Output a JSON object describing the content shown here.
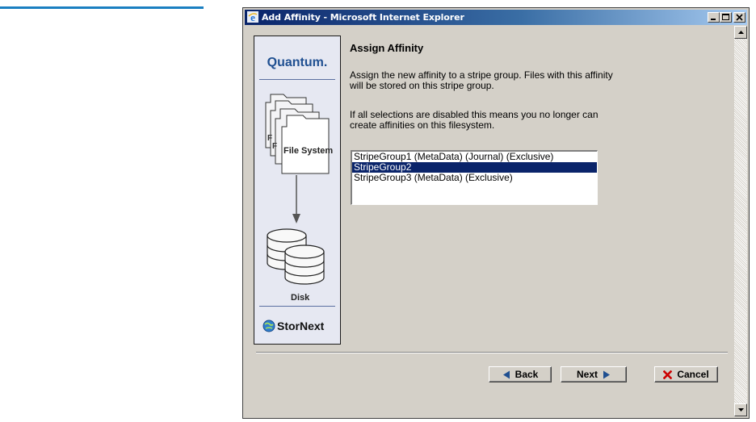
{
  "window": {
    "title": "Add Affinity - Microsoft Internet Explorer"
  },
  "sidebar": {
    "logo": "Quantum.",
    "file_system_label": "File System",
    "disk_label": "Disk",
    "brand": "StorNext"
  },
  "content": {
    "heading": "Assign Affinity",
    "para1_line1": "Assign the new affinity to a stripe group. Files with this affinity",
    "para1_line2": "will be stored on this stripe group.",
    "para2_line1": "If all selections are disabled this means you no longer can",
    "para2_line2": "create affinities on this filesystem.",
    "stripe_groups": [
      {
        "label": "StripeGroup1 (MetaData)  (Journal)  (Exclusive)",
        "selected": false
      },
      {
        "label": "StripeGroup2",
        "selected": true
      },
      {
        "label": "StripeGroup3 (MetaData)  (Exclusive)",
        "selected": false
      }
    ]
  },
  "buttons": {
    "back": "Back",
    "next": "Next",
    "cancel": "Cancel"
  },
  "icons": {
    "back": "triangle-left-icon",
    "next": "triangle-right-icon",
    "cancel": "red-x-icon",
    "window": "internet-explorer-icon"
  },
  "colors": {
    "selection": "#0a246a",
    "titlebar_start": "#0a246a",
    "titlebar_end": "#a6caf0",
    "arrow_blue": "#1f4f91",
    "cancel_red": "#cc0000",
    "accent_rule": "#1a7fc1"
  }
}
